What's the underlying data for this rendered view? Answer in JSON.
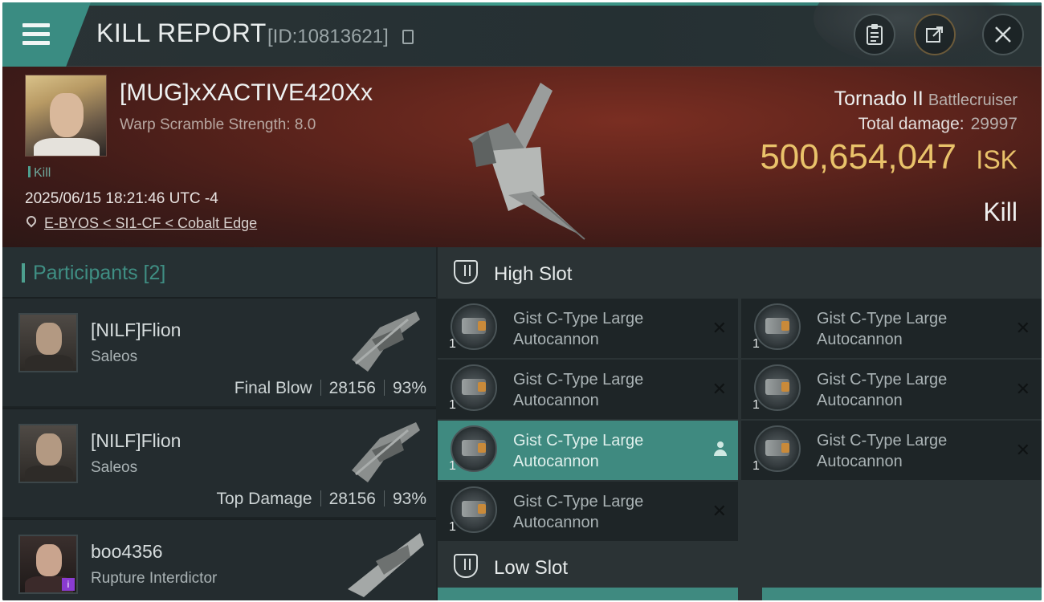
{
  "header": {
    "title": "KILL REPORT",
    "report_id": "[ID:10813621]"
  },
  "victim": {
    "name": "[MUG]xXACTIVE420Xx",
    "warp_scramble": "Warp Scramble Strength: 8.0",
    "tag": "Kill",
    "datetime": "2025/06/15 18:21:46 UTC -4",
    "location": "E-BYOS < SI1-CF < Cobalt Edge",
    "ship_name": "Tornado II",
    "ship_class": "Battlecruiser",
    "total_damage_label": "Total damage:",
    "total_damage": "29997",
    "isk_value": "500,654,047",
    "isk_unit": "ISK",
    "result": "Kill"
  },
  "participants": {
    "title": "Participants [2]",
    "items": [
      {
        "name": "[NILF]Flion",
        "ship": "Saleos",
        "role": "Final Blow",
        "damage": "28156",
        "percent": "93%"
      },
      {
        "name": "[NILF]Flion",
        "ship": "Saleos",
        "role": "Top Damage",
        "damage": "28156",
        "percent": "93%"
      },
      {
        "name": "boo4356",
        "ship": "Rupture Interdictor",
        "badge": "i"
      }
    ]
  },
  "fitting": {
    "high_slot_title": "High Slot",
    "low_slot_title": "Low Slot",
    "high_slot": [
      {
        "line1": "Gist C-Type Large",
        "line2": "Autocannon",
        "qty": "1",
        "status": "destroyed"
      },
      {
        "line1": "Gist C-Type Large",
        "line2": "Autocannon",
        "qty": "1",
        "status": "destroyed"
      },
      {
        "line1": "Gist C-Type Large",
        "line2": "Autocannon",
        "qty": "1",
        "status": "destroyed"
      },
      {
        "line1": "Gist C-Type Large",
        "line2": "Autocannon",
        "qty": "1",
        "status": "destroyed"
      },
      {
        "line1": "Gist C-Type Large",
        "line2": "Autocannon",
        "qty": "1",
        "status": "dropped"
      },
      {
        "line1": "Gist C-Type Large",
        "line2": "Autocannon",
        "qty": "1",
        "status": "destroyed"
      },
      {
        "line1": "Gist C-Type Large",
        "line2": "Autocannon",
        "qty": "1",
        "status": "destroyed"
      }
    ],
    "destroyed_glyph": "✕"
  },
  "colors": {
    "accent": "#3f8a80",
    "isk": "#e9c26a",
    "banner": "#5e241c",
    "purple_badge": "#8a3bd1"
  }
}
